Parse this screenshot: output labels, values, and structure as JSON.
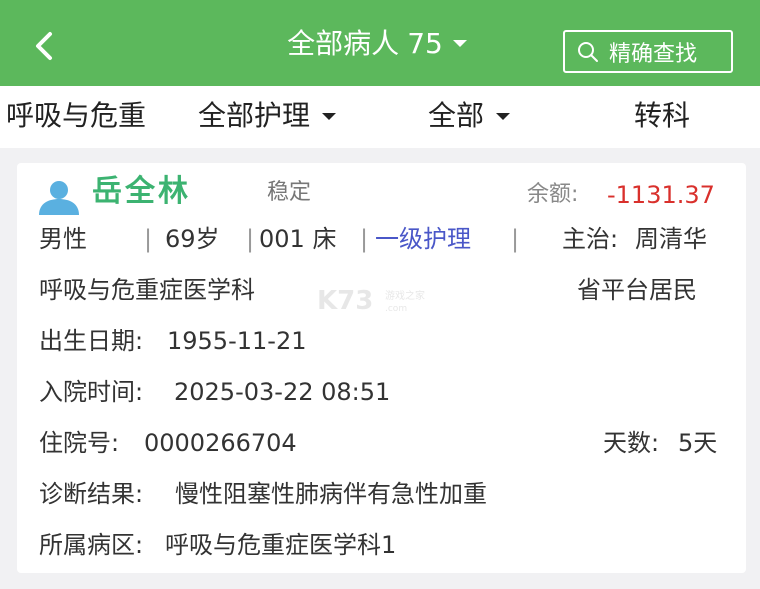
{
  "header": {
    "title": "全部病人",
    "count": "75",
    "search_label": "精确查找"
  },
  "filters": {
    "department": "呼吸与危重",
    "nursing_filter": "全部护理",
    "scope_filter": "全部",
    "transfer_label": "转科"
  },
  "patient": {
    "name": "岳全林",
    "status": "稳定",
    "balance_label": "余额:",
    "balance_value": "-1131.37",
    "gender": "男性",
    "age": "69岁",
    "bed": "001 床",
    "nursing_level": "一级护理",
    "doctor_label": "主治:",
    "doctor_name": "周清华",
    "department": "呼吸与危重症医学科",
    "insurance": "省平台居民",
    "birth_label": "出生日期:",
    "birth_date": "1955-11-21",
    "admit_label": "入院时间:",
    "admit_time": "2025-03-22 08:51",
    "inpatient_label": "住院号:",
    "inpatient_no": "0000266704",
    "days_label": "天数:",
    "days_value": "5天",
    "diagnosis_label": "诊断结果:",
    "diagnosis": "慢性阻塞性肺病伴有急性加重",
    "ward_label": "所属病区:",
    "ward": "呼吸与危重症医学科1"
  },
  "watermark_text": "K73 游戏之家",
  "colors": {
    "header_bg": "#5cb85c",
    "name": "#3cb371",
    "balance": "#d9302c",
    "nursing_level": "#4a57c8"
  }
}
